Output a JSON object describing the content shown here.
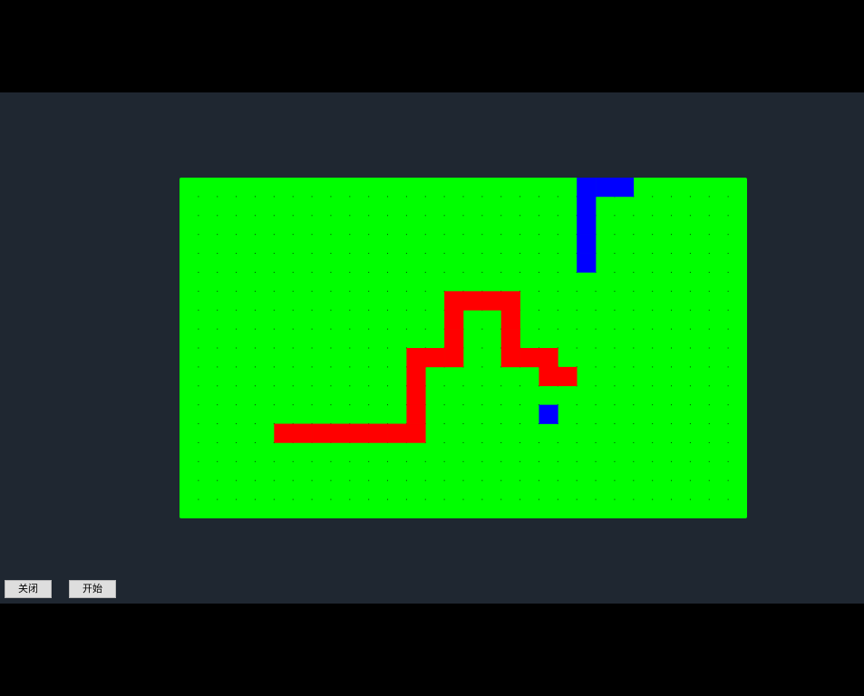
{
  "controls": {
    "close_label": "关闭",
    "start_label": "开始"
  },
  "game": {
    "grid": {
      "cols": 30,
      "rows": 18
    },
    "colors": {
      "board": "#00ff00",
      "snake": "#ff0000",
      "obstacle": "#0000ff",
      "grid_dot": "#004400",
      "background": "#1f2731",
      "letterbox": "#000000"
    },
    "snake": [
      [
        5,
        13
      ],
      [
        6,
        13
      ],
      [
        7,
        13
      ],
      [
        8,
        13
      ],
      [
        9,
        13
      ],
      [
        10,
        13
      ],
      [
        11,
        13
      ],
      [
        12,
        13
      ],
      [
        12,
        12
      ],
      [
        12,
        11
      ],
      [
        12,
        10
      ],
      [
        12,
        9
      ],
      [
        13,
        9
      ],
      [
        14,
        9
      ],
      [
        14,
        8
      ],
      [
        14,
        7
      ],
      [
        14,
        6
      ],
      [
        15,
        6
      ],
      [
        16,
        6
      ],
      [
        17,
        6
      ],
      [
        17,
        7
      ],
      [
        17,
        8
      ],
      [
        17,
        9
      ],
      [
        18,
        9
      ],
      [
        19,
        9
      ],
      [
        19,
        10
      ],
      [
        20,
        10
      ]
    ],
    "obstacles": [
      [
        21,
        0
      ],
      [
        22,
        0
      ],
      [
        23,
        0
      ],
      [
        21,
        1
      ],
      [
        21,
        2
      ],
      [
        21,
        3
      ],
      [
        21,
        4
      ],
      [
        19,
        12
      ]
    ]
  }
}
